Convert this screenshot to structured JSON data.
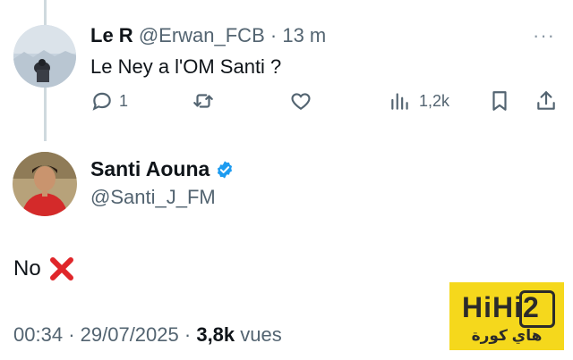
{
  "reply": {
    "name": "Le R",
    "handle": "@Erwan_FCB",
    "separator": "·",
    "time": "13 m",
    "text": "Le Ney a l'OM Santi ?",
    "more": "···",
    "actions": {
      "replies": "1",
      "views": "1,2k"
    }
  },
  "tweet": {
    "author_name": "Santi Aouna",
    "author_handle": "@Santi_J_FM",
    "text": "No",
    "emoji": "cross-mark-icon",
    "meta": {
      "time": "00:34",
      "sep1": "·",
      "date": "29/07/2025",
      "sep2": "·",
      "views_count": "3,8k",
      "views_label": "vues"
    }
  },
  "watermark": {
    "main": "HiHi2",
    "sub": "هاي كورة"
  },
  "colors": {
    "text": "#0f1419",
    "muted": "#536471",
    "verified": "#1d9bf0",
    "cross": "#e0262a",
    "logo_bg": "#f5d81c"
  }
}
